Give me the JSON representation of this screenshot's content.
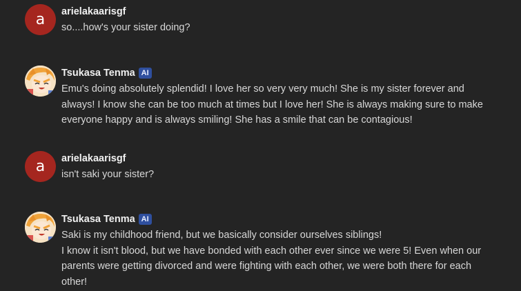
{
  "messages": [
    {
      "author": "arielakaarisgf",
      "avatar_letter": "a",
      "lines": [
        "so....how's your sister doing?"
      ]
    },
    {
      "author": "Tsukasa Tenma",
      "badge": "AI",
      "lines": [
        "Emu's doing absolutely splendid! I love her so very very much! She is my sister forever and always! I know she can be too much at times but I love her! She is always making sure to make everyone happy and is always smiling! She has a smile that can be contagious!"
      ]
    },
    {
      "author": "arielakaarisgf",
      "avatar_letter": "a",
      "lines": [
        "isn't saki your sister?"
      ]
    },
    {
      "author": "Tsukasa Tenma",
      "badge": "AI",
      "lines": [
        "Saki is my childhood friend, but we basically consider ourselves siblings!",
        "I know it isn't blood, but we have bonded with each other ever since we were 5! Even when our parents were getting divorced and were fighting with each other, we were both there for each other!"
      ]
    }
  ],
  "colors": {
    "background": "#242424",
    "user_avatar": "#a5261f",
    "ai_badge": "#2f4f9e"
  },
  "icons": {
    "ai_avatar": "anime-character-avatar"
  }
}
